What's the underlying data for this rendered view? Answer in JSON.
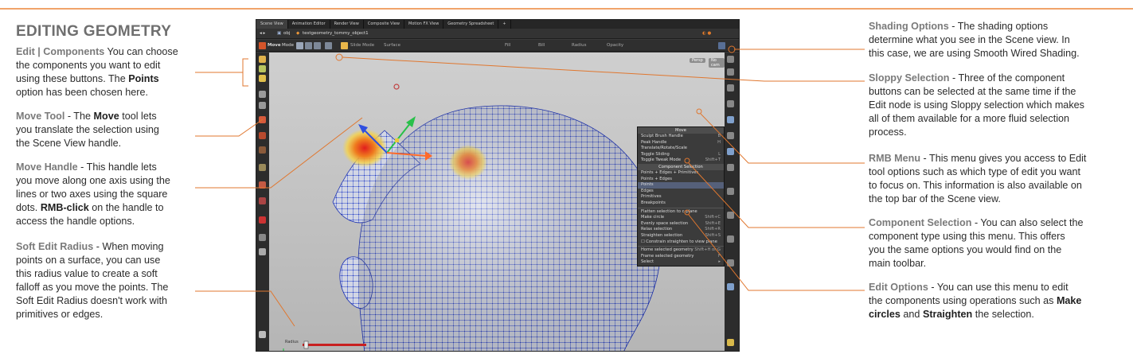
{
  "title": "EDITING GEOMETRY",
  "left": {
    "edit_components": {
      "label": "Edit | Components",
      "text_lines": [
        " You can choose",
        "the components you want to edit",
        "using these buttons. The ",
        "Points",
        "option has been chosen here."
      ]
    },
    "move_tool": {
      "label": "Move Tool",
      "l1a": " - The ",
      "l1b": "Move",
      "l1c": " tool lets",
      "l2": "you translate the selection using",
      "l3": "the Scene View handle."
    },
    "move_handle": {
      "label": "Move Handle",
      "l1": " - This handle lets",
      "l2": "you move along one axis using the",
      "l3": "lines or two axes using the square",
      "l4": "dots. ",
      "l4b": "RMB-click",
      "l4c": " on the handle to",
      "l5": "access the handle options."
    },
    "soft_edit": {
      "label": "Soft Edit Radius",
      "l1": " - When moving",
      "l2": "points on a surface, you can use",
      "l3": "this radius value to create a soft",
      "l4": "falloff as you move the points. The",
      "l5": "Soft Edit Radius doesn't work with",
      "l6": "primitives or edges."
    }
  },
  "right": {
    "shading": {
      "label": "Shading Options",
      "l1": " - The shading options",
      "l2": "determine what you see in the Scene view. In",
      "l3": "this case, we are using Smooth Wired Shading."
    },
    "sloppy": {
      "label": "Sloppy Selection",
      "l1": " - Three of the component",
      "l2": "buttons can be selected at the same time if the",
      "l3": "Edit node is using Sloppy selection which makes",
      "l4": "all of them available for a more fluid selection",
      "l5": "process."
    },
    "rmb": {
      "label": "RMB Menu",
      "l1": " - This menu gives you access to Edit",
      "l2": "tool options such as which type of edit you want",
      "l3": "to focus on. This information is also available on",
      "l4": "the top bar of the Scene view."
    },
    "component_sel": {
      "label": "Component Selection",
      "l1": " - You can also select the",
      "l2": "component type using this menu. This offers",
      "l3": "you the same options you would find on the",
      "l4": "main toolbar."
    },
    "edit_options": {
      "label": "Edit Options",
      "l1": " - You can use this menu to edit",
      "l2": "the components using operations such as ",
      "l2b": "Make",
      "l3": "circles",
      "l3b": " and ",
      "l3c": "Straighten",
      "l3d": " the selection."
    }
  },
  "app": {
    "tabs": [
      "Scene View",
      "Animation Editor",
      "Render View",
      "Composite View",
      "Motion FX View",
      "Geometry Spreadsheet"
    ],
    "path_obj": "obj",
    "path_node": "testgeometry_tommy_object1",
    "tool_name": "Move",
    "tool_mode": "Mode",
    "mode_field": "Slide Mode",
    "surface_field": "Surface",
    "fields": [
      "Fill",
      "Bill",
      "Radius",
      "Opacity"
    ],
    "persp_label": "Persp",
    "cam_label": "No cam",
    "radius_hud": "Radius",
    "menu": {
      "header": "Move",
      "items1": [
        {
          "label": "Sculpt Brush Handle",
          "sc": "B"
        },
        {
          "label": "Peak Handle",
          "sc": "H"
        },
        {
          "label": "Translate/Rotate/Scale",
          "sc": ""
        },
        {
          "label": "Toggle Sliding",
          "sc": "L"
        },
        {
          "label": "Toggle Tweak Mode",
          "sc": "Shift+T"
        }
      ],
      "subheader": "Component Selection",
      "items2": [
        "Points + Edges + Primitives",
        "Points + Edges",
        "Points",
        "Edges",
        "Primitives",
        "Breakpoints"
      ],
      "items3": [
        {
          "label": "Flatten selection to c-plane",
          "sc": ""
        },
        {
          "label": "Make circle",
          "sc": "Shift+C"
        },
        {
          "label": "Evenly space selection",
          "sc": "Shift+E"
        },
        {
          "label": "Relax selection",
          "sc": "Shift+R"
        },
        {
          "label": "Straighten selection",
          "sc": "Shift+S"
        },
        {
          "label": "☐ Constrain straighten to view plane",
          "sc": ""
        }
      ],
      "items4": [
        {
          "label": "Home selected geometry",
          "sc": "Shift+H or G"
        },
        {
          "label": "Frame selected geometry",
          "sc": "F"
        },
        {
          "label": "Select",
          "sc": "▸"
        }
      ]
    }
  },
  "colors": {
    "accent": "#f1a36a",
    "label_gray": "#7a7a7a",
    "mesh": "#1f3fd0",
    "leader": "#e0772f"
  }
}
